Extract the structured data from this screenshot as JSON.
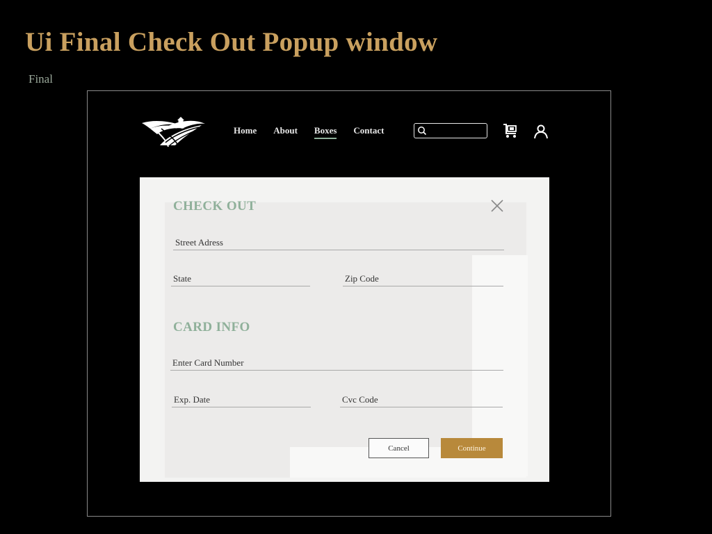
{
  "slide": {
    "title": "Ui Final Check Out Popup window",
    "subtitle": "Final"
  },
  "nav": {
    "items": [
      {
        "label": "Home",
        "active": false
      },
      {
        "label": "About",
        "active": false
      },
      {
        "label": "Boxes",
        "active": true
      },
      {
        "label": "Contact",
        "active": false
      }
    ],
    "search_placeholder": ""
  },
  "icons": {
    "logo": "farm-logo",
    "search": "search-icon",
    "cart": "cart-icon",
    "user": "user-icon",
    "close": "close-icon"
  },
  "checkout": {
    "heading": "CHECK OUT",
    "street_placeholder": "Street Adress",
    "state_placeholder": "State",
    "zip_placeholder": "Zip Code",
    "card_heading": "CARD INFO",
    "card_number_placeholder": "Enter Card Number",
    "exp_placeholder": "Exp. Date",
    "cvc_placeholder": "Cvc Code",
    "cancel_label": "Cancel",
    "continue_label": "Continue"
  },
  "colors": {
    "title_gold": "#c9a05f",
    "subtitle": "#9aa89a",
    "heading_green": "#8fb09a",
    "continue_gold": "#b8893b",
    "modal_bg": "#f3f3f2",
    "page_bg": "#000000"
  }
}
